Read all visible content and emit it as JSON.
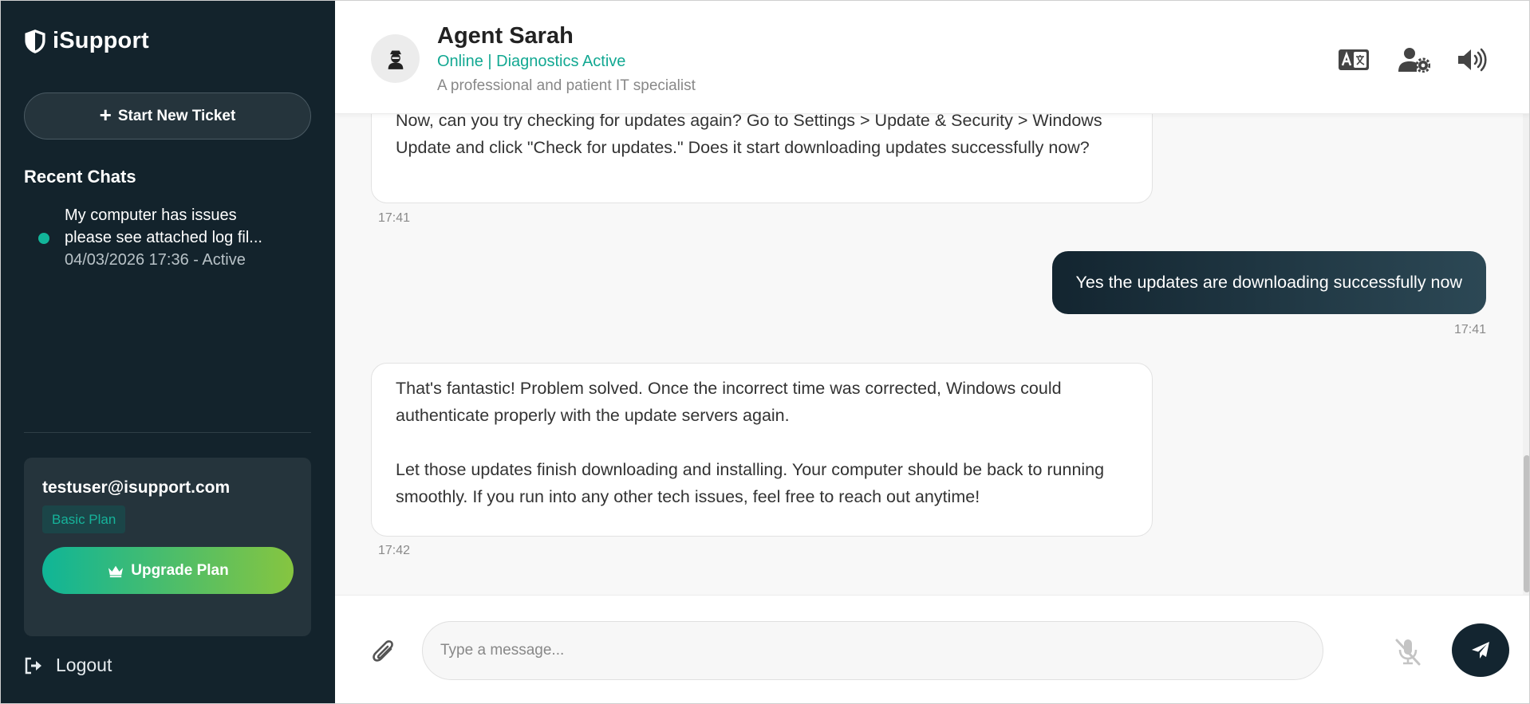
{
  "sidebar": {
    "brand": "iSupport",
    "new_ticket_label": "Start New Ticket",
    "recent_title": "Recent Chats",
    "recent_chats": [
      {
        "line1": "My computer has issues",
        "line2": "please see attached log fil...",
        "meta": "04/03/2026 17:36 - Active",
        "status_color": "#12b59a"
      }
    ],
    "account": {
      "email": "testuser@isupport.com",
      "plan": "Basic Plan",
      "upgrade_label": "Upgrade Plan"
    },
    "logout_label": "Logout"
  },
  "header": {
    "agent_name": "Agent Sarah",
    "status": "Online | Diagnostics Active",
    "description": "A professional and patient IT specialist",
    "icons": [
      "translate-icon",
      "user-settings-icon",
      "volume-icon"
    ]
  },
  "messages": [
    {
      "role": "agent",
      "paragraphs": [
        "Now, can you try checking for updates again? Go to Settings > Update & Security > Windows Update and click \"Check for updates.\" Does it start downloading updates successfully now?"
      ],
      "time": "17:41"
    },
    {
      "role": "user",
      "text": "Yes the updates are downloading successfully now",
      "time": "17:41"
    },
    {
      "role": "agent",
      "paragraphs": [
        "That's fantastic! Problem solved. Once the incorrect time was corrected, Windows could authenticate properly with the update servers again.",
        "Let those updates finish downloading and installing. Your computer should be back to running smoothly. If you run into any other tech issues, feel free to reach out anytime!"
      ],
      "time": "17:42"
    }
  ],
  "composer": {
    "placeholder": "Type a message..."
  },
  "colors": {
    "sidebar_bg": "#13232c",
    "accent": "#12b59a",
    "user_bubble": "#132530"
  }
}
